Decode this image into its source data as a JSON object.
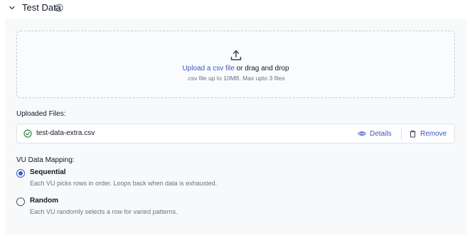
{
  "section": {
    "title": "Test Data",
    "chevron_icon": "chevron-down-icon",
    "info_icon": "info-icon"
  },
  "upload": {
    "icon": "upload-icon",
    "link_text": "Upload a csv file",
    "after_link_text": " or drag and drop",
    "hint": ".csv file up to 10MB. Max upto 3 files"
  },
  "uploaded_files": {
    "label": "Uploaded Files:",
    "files": [
      {
        "name": "test-data-extra.csv",
        "status_icon": "check-circle-icon",
        "details_label": "Details",
        "details_icon": "eye-icon",
        "remove_label": "Remove",
        "remove_icon": "trash-icon"
      }
    ]
  },
  "vu_mapping": {
    "label": "VU Data Mapping:",
    "options": [
      {
        "title": "Sequential",
        "description": "Each VU picks rows in order. Loops back when data is exhausted.",
        "selected": true
      },
      {
        "title": "Random",
        "description": "Each VU randomly selects a row for varied patterns.",
        "selected": false
      }
    ]
  },
  "colors": {
    "accent": "#3b57c6",
    "success": "#2f8a4c",
    "panel_bg": "#f8f9fa",
    "muted_text": "#6b7280"
  }
}
